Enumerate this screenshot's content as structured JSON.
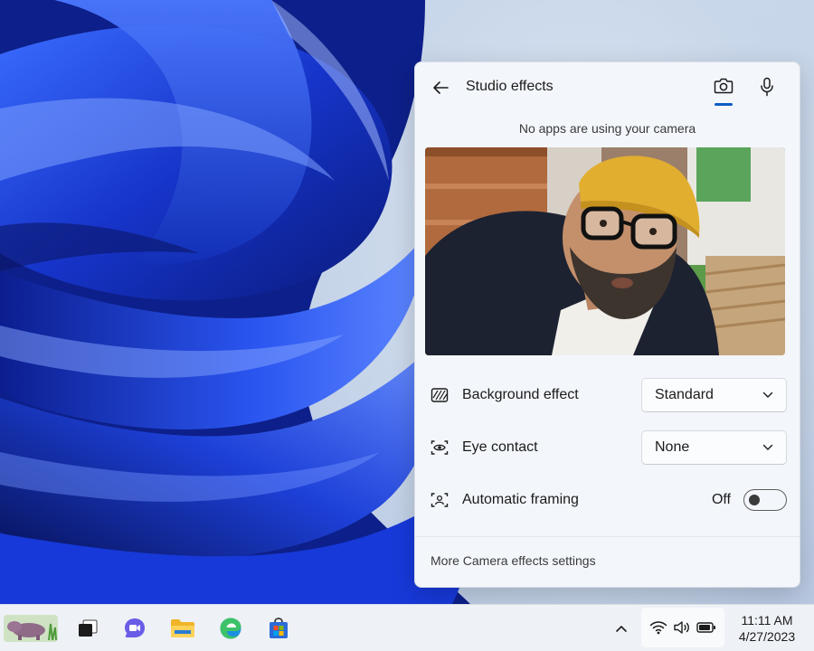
{
  "flyout": {
    "title": "Studio effects",
    "back_icon": "arrow-left-icon",
    "tabs": [
      {
        "icon": "camera-icon",
        "selected": true
      },
      {
        "icon": "microphone-icon",
        "selected": false
      }
    ],
    "status": "No apps are using your camera",
    "settings": [
      {
        "label": "Background effect",
        "icon": "background-blur-icon",
        "value": "Standard"
      },
      {
        "label": "Eye contact",
        "icon": "eye-contact-icon",
        "value": "None"
      },
      {
        "label": "Automatic framing",
        "icon": "framing-icon",
        "toggle_label": "Off",
        "enabled": false
      }
    ],
    "footer_link": "More Camera effects settings"
  },
  "taskbar": {
    "apps": [
      "hippo-widget-icon",
      "task-view-icon",
      "teams-chat-icon",
      "file-explorer-icon",
      "edge-icon",
      "store-icon"
    ],
    "tray_icons": [
      "chevron-up-icon",
      "wifi-icon",
      "volume-icon",
      "battery-icon"
    ],
    "time": "11:11 AM",
    "date": "4/27/2023"
  },
  "colors": {
    "accent": "#0b5cc3",
    "wallpaper_blue": "#1a3fd6",
    "flyout_bg": "#f3f6fb",
    "taskbar_bg": "#eef1f6"
  }
}
